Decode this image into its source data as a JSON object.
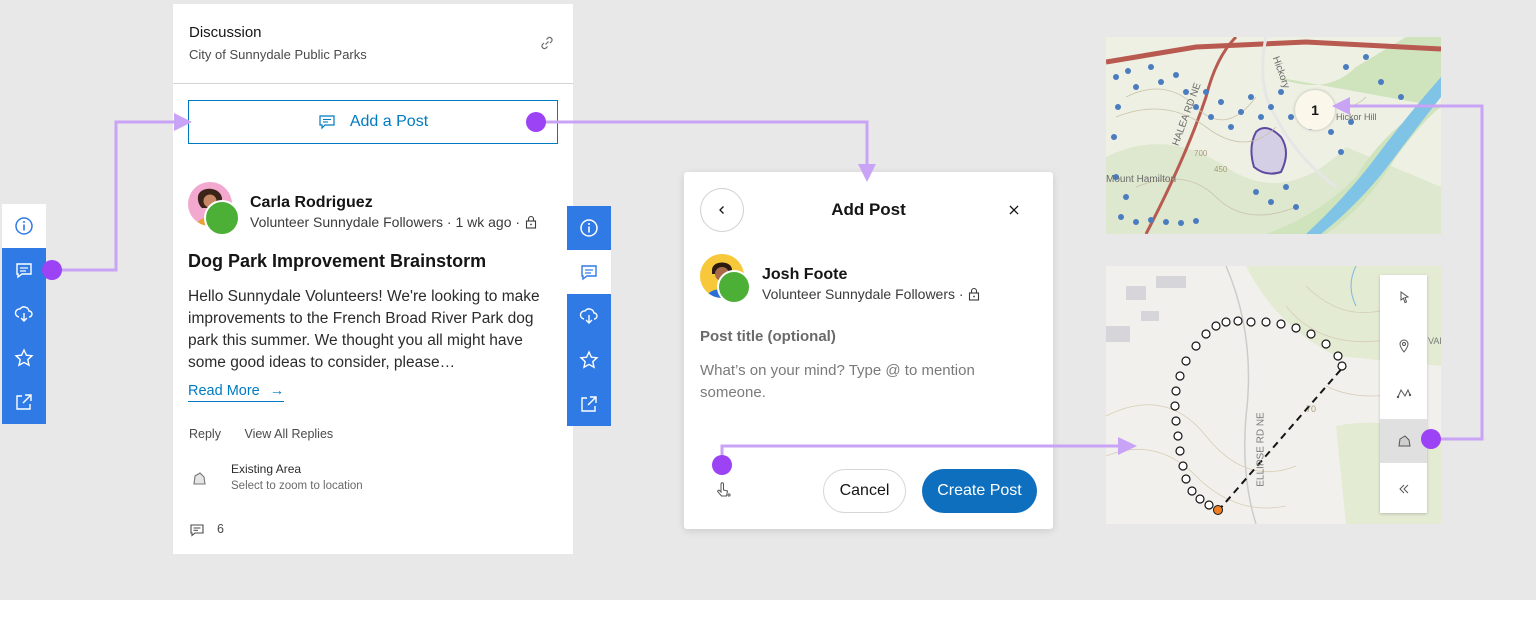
{
  "discussion": {
    "title": "Discussion",
    "subtitle": "City of Sunnydale Public Parks",
    "add_post_label": "Add a Post",
    "post": {
      "author": "Carla Rodriguez",
      "meta": "Volunteer Sunnydale Followers · 1 wk ago ·",
      "title": "Dog Park Improvement Brainstorm",
      "body": "Hello Sunnydale Volunteers! We're looking to make improvements to the French Broad River Park dog park this summer. We thought you all might have some good ideas to consider, please…",
      "read_more": "Read More",
      "reply": "Reply",
      "view_all_replies": "View All Replies",
      "attachment_title": "Existing Area",
      "attachment_sub": "Select to zoom to location",
      "comment_count": "6"
    }
  },
  "dialog": {
    "title": "Add Post",
    "author": "Josh Foote",
    "meta": "Volunteer Sunnydale Followers ·",
    "post_title_label": "Post title (optional)",
    "body_placeholder": "What’s on your mind? Type @ to mention someone.",
    "cancel_label": "Cancel",
    "create_label": "Create Post"
  },
  "map_top": {
    "cluster_count": "1",
    "labels": [
      "HALEA RD NE",
      "Hickory",
      "Hickor Hill",
      "Mount Hamilton",
      "700",
      "450"
    ]
  },
  "map_bottom": {
    "labels": [
      "ELLIPSE RD NE",
      "70",
      "VAL"
    ]
  },
  "colors": {
    "action_bar": "#2f7ae5",
    "brand_blue": "#007ac2",
    "connector": "#a970f0",
    "connector_dot": "#9c43f5",
    "create_button": "#0d6fbd"
  },
  "icons": {
    "action_bar": [
      "info-icon",
      "chat-icon",
      "download-icon",
      "star-icon",
      "share-icon"
    ],
    "draw_tools": [
      "pointer-icon",
      "pin-icon",
      "polyline-icon",
      "polygon-icon",
      "collapse-icon"
    ]
  }
}
